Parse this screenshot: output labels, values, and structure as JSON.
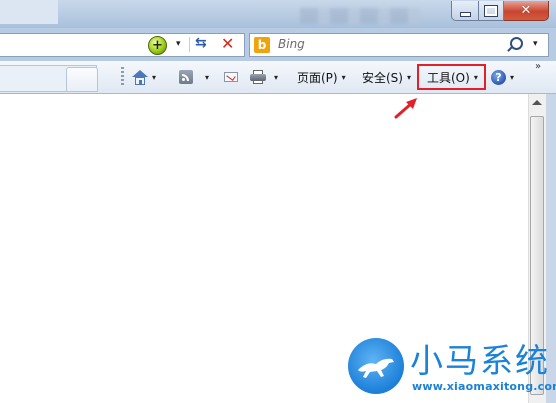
{
  "window": {
    "controls": {
      "minimize_icon": "minimize-icon",
      "maximize_icon": "maximize-icon",
      "close_icon": "close-icon",
      "close_glyph": "✕"
    }
  },
  "address_bar": {
    "compat_icon": "compatibility-view-icon",
    "compat_glyph": "+",
    "dropdown_glyph": "▾",
    "refresh_glyph": "⇆",
    "stop_glyph": "✕"
  },
  "search_bar": {
    "provider_logo": "b",
    "placeholder": "Bing",
    "dropdown_glyph": "▾"
  },
  "command_bar": {
    "home_dropdown": "▾",
    "feeds_dropdown": "▾",
    "print_dropdown": "▾",
    "page_label": "页面(P)",
    "safety_label": "安全(S)",
    "tools_label": "工具(O)",
    "help_glyph": "?",
    "help_dropdown": "▾",
    "more_glyph": "»",
    "dd_glyph": "▾",
    "highlight_color": "#e3202a"
  },
  "watermark": {
    "title": "小马系统",
    "url": "www.xiaomaxitong.com",
    "color": "#1a82d8"
  }
}
